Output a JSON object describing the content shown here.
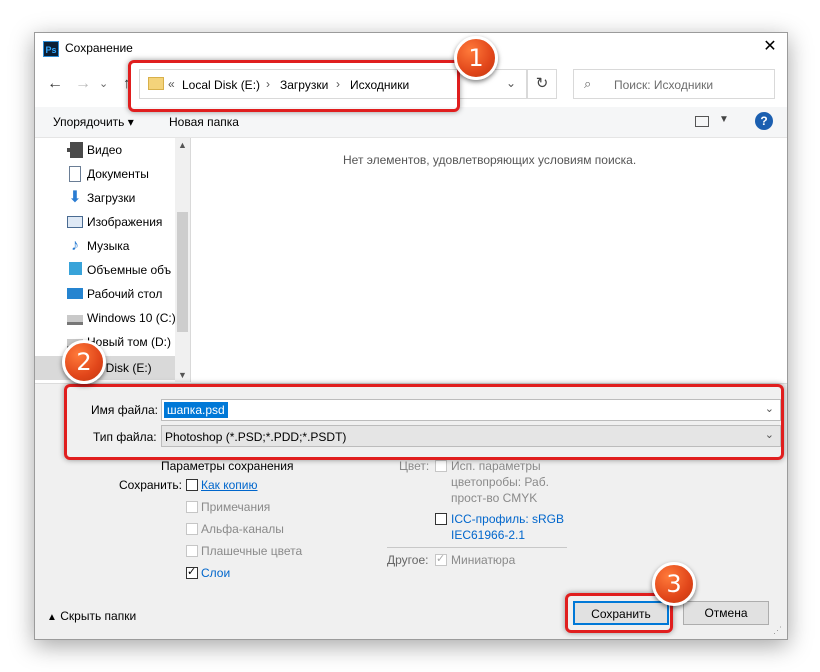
{
  "window": {
    "title": "Сохранение",
    "app_icon_text": "Ps"
  },
  "address_bar": {
    "overflow": "«",
    "crumbs": [
      "Local Disk (E:)",
      "Загрузки",
      "Исходники"
    ]
  },
  "search": {
    "placeholder": "Поиск: Исходники"
  },
  "toolbar": {
    "organize": "Упорядочить",
    "new_folder": "Новая папка"
  },
  "nav_tree": {
    "items": [
      {
        "label": "Видео",
        "icon": "video-icon"
      },
      {
        "label": "Документы",
        "icon": "documents-icon"
      },
      {
        "label": "Загрузки",
        "icon": "downloads-icon"
      },
      {
        "label": "Изображения",
        "icon": "pictures-icon"
      },
      {
        "label": "Музыка",
        "icon": "music-icon"
      },
      {
        "label": "Объемные объ",
        "icon": "3d-objects-icon"
      },
      {
        "label": "Рабочий стол",
        "icon": "desktop-icon"
      },
      {
        "label": "Windows 10 (C:)",
        "icon": "drive-icon"
      },
      {
        "label": "Новый том (D:)",
        "icon": "drive-icon"
      },
      {
        "label": "Local Disk (E:)",
        "icon": "drive-icon"
      }
    ],
    "selected_label_visible": "al Disk (E:)"
  },
  "content": {
    "empty_message": "Нет элементов, удовлетворяющих условиям поиска."
  },
  "file": {
    "name_label": "Имя файла:",
    "name_value": "шапка.psd",
    "type_label": "Тип файла:",
    "type_value": "Photoshop (*.PSD;*.PDD;*.PSDT)"
  },
  "save_options": {
    "heading": "Параметры сохранения",
    "save_label": "Сохранить:",
    "as_copy": "Как копию",
    "notes": "Примечания",
    "alpha": "Альфа-каналы",
    "spot": "Плашечные цвета",
    "layers": "Слои",
    "color_label": "Цвет:",
    "proof_line1": "Исп. параметры",
    "proof_line2": "цветопробы:  Раб.",
    "proof_line3": "прост-во CMYK",
    "icc_line1": "ICC-профиль:  sRGB",
    "icc_line2": "IEC61966-2.1",
    "other_label": "Другое:",
    "thumbnail": "Миниатюра"
  },
  "footer": {
    "hide_folders": "Скрыть папки",
    "save": "Сохранить",
    "cancel": "Отмена"
  },
  "annotations": {
    "one": "1",
    "two": "2",
    "three": "3"
  },
  "colors": {
    "highlight": "#e01e1e",
    "badge": "#e1461a",
    "selection": "#0078d7"
  }
}
